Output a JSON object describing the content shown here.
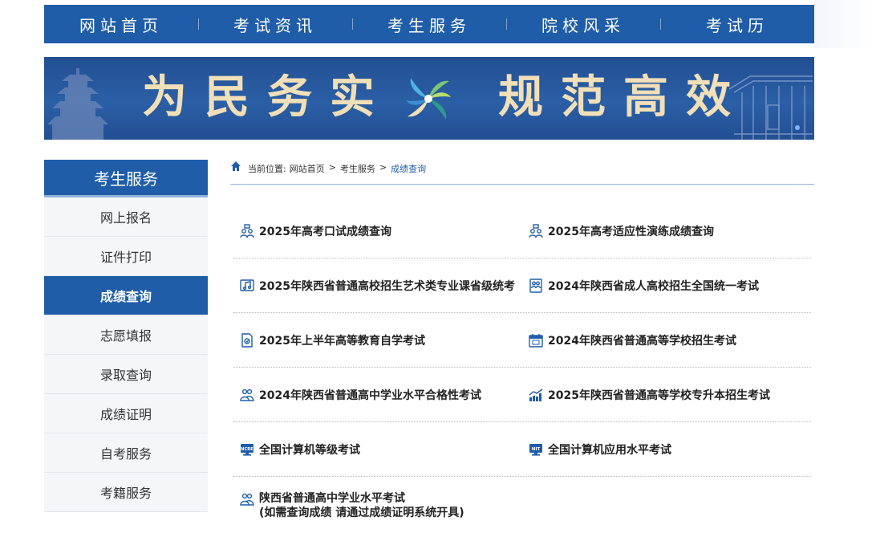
{
  "nav": {
    "items": [
      "网站首页",
      "考试资讯",
      "考生服务",
      "院校风采",
      "考试历"
    ]
  },
  "banner": {
    "slogan_left": "为民务实",
    "slogan_right": "规范高效"
  },
  "sidebar": {
    "title": "考生服务",
    "items": [
      "网上报名",
      "证件打印",
      "成绩查询",
      "志愿填报",
      "录取查询",
      "成绩证明",
      "自考服务",
      "考籍服务"
    ],
    "active_index": 2
  },
  "breadcrumb": {
    "prefix": "当前位置:",
    "items": [
      "网站首页",
      "考生服务",
      "成绩查询"
    ],
    "separator": ">"
  },
  "exams": [
    {
      "label": "2025年高考口试成绩查询",
      "icon": "people-icon"
    },
    {
      "label": "2025年高考适应性演练成绩查询",
      "icon": "people-icon"
    },
    {
      "label": "2025年陕西省普通高校招生艺术类专业课省级统考",
      "icon": "music-icon"
    },
    {
      "label": "2024年陕西省成人高校招生全国统一考试",
      "icon": "people-icon"
    },
    {
      "label": "2025年上半年高等教育自学考试",
      "icon": "document-icon"
    },
    {
      "label": "2024年陕西省普通高等学校招生考试",
      "icon": "calendar-icon"
    },
    {
      "label": "2024年陕西省普通高中学业水平合格性考试",
      "icon": "people-icon"
    },
    {
      "label": "2025年陕西省普通高等学校专升本招生考试",
      "icon": "chart-icon"
    },
    {
      "label": "全国计算机等级考试",
      "icon": "ncre-monitor-icon",
      "badge": "NCRE"
    },
    {
      "label": "全国计算机应用水平考试",
      "icon": "nit-monitor-icon",
      "badge": "NIT"
    },
    {
      "label": "陕西省普通高中学业水平考试",
      "label_line2": "(如需查询成绩 请通过成绩证明系统开具)",
      "icon": "people-icon"
    }
  ],
  "colors": {
    "primary": "#1f5da8",
    "banner_text": "#f1dfb8",
    "link": "#1f5da8"
  }
}
